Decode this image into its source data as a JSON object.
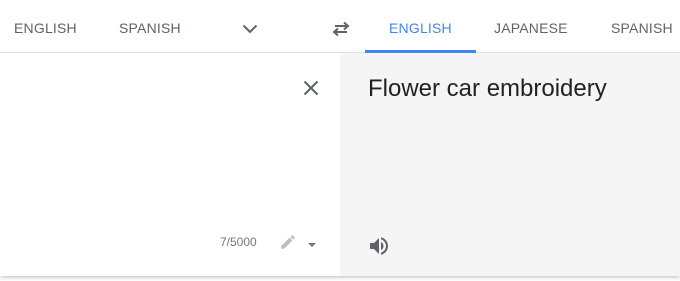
{
  "source_languages": {
    "tabs": [
      {
        "label": "ENGLISH"
      },
      {
        "label": "SPANISH"
      }
    ],
    "more_icon": "chevron-down-icon"
  },
  "swap_icon": "swap-icon",
  "target_languages": {
    "tabs": [
      {
        "label": "ENGLISH",
        "active": true
      },
      {
        "label": "JAPANESE"
      },
      {
        "label": "SPANISH"
      }
    ]
  },
  "source": {
    "text": "",
    "char_count": "7/5000",
    "clear_icon": "close-icon",
    "edit_icon": "pencil-icon"
  },
  "target": {
    "translation": "Flower car embroidery",
    "listen_icon": "speaker-icon"
  },
  "colors": {
    "accent": "#4285f4",
    "tab_text": "#5f6368",
    "target_bg": "#f5f5f5"
  }
}
